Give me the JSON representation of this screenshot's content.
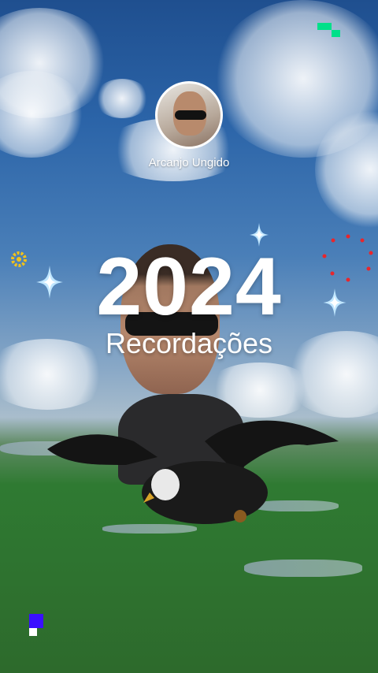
{
  "profile": {
    "username": "Arcanjo Ungido"
  },
  "memories": {
    "year": "2024",
    "title": "Recordações"
  },
  "colors": {
    "accent_green": "#00e08a",
    "accent_blue": "#3a10ff",
    "gold": "#f1c21b",
    "red_ring": "#e8262c"
  }
}
